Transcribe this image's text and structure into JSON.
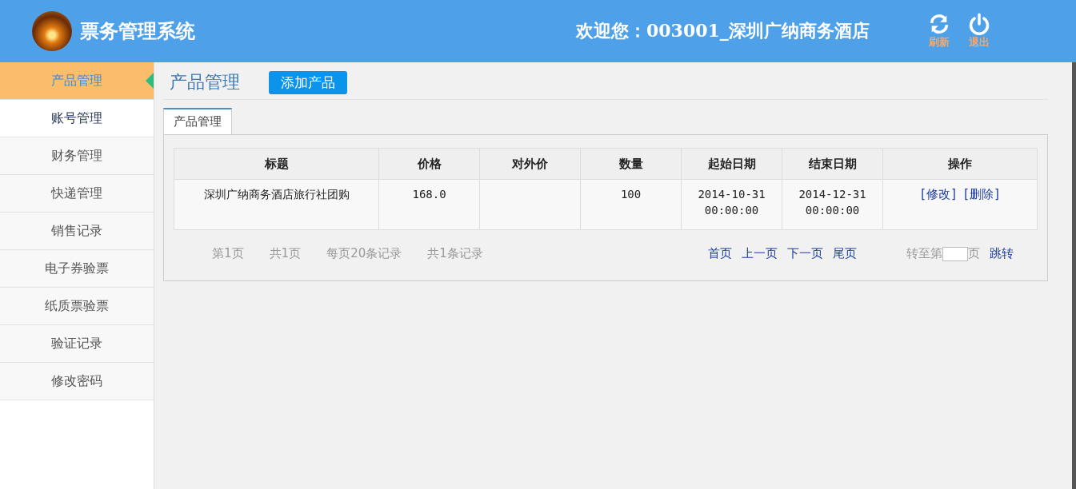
{
  "header": {
    "title": "票务管理系统",
    "welcome": "欢迎您：003001_深圳广纳商务酒店",
    "actions": [
      {
        "kind": "refresh",
        "label": "刷新"
      },
      {
        "kind": "logout",
        "label": "退出"
      }
    ]
  },
  "sidebar": {
    "items": [
      {
        "label": "产品管理",
        "selected": true
      },
      {
        "label": "账号管理",
        "selected": false
      },
      {
        "label": "财务管理",
        "selected": false
      },
      {
        "label": "快递管理",
        "selected": false
      },
      {
        "label": "销售记录",
        "selected": false
      },
      {
        "label": "电子券验票",
        "selected": false
      },
      {
        "label": "纸质票验票",
        "selected": false
      },
      {
        "label": "验证记录",
        "selected": false
      },
      {
        "label": "修改密码",
        "selected": false
      }
    ]
  },
  "page": {
    "title": "产品管理",
    "add_button": "添加产品"
  },
  "tabs": [
    {
      "label": "产品管理",
      "selected": true
    }
  ],
  "table": {
    "columns": [
      "标题",
      "价格",
      "对外价",
      "数量",
      "起始日期",
      "结束日期",
      "操作"
    ],
    "rows": [
      {
        "title": "深圳广纳商务酒店旅行社团购",
        "price": "168.0",
        "quantity": "100",
        "start_date": "2014-10-31 00:00:00",
        "end_date": "2014-12-31 00:00:00",
        "actions": [
          "[修改]",
          "[删除]"
        ]
      }
    ]
  },
  "pagination": {
    "info": [
      "第1页",
      "共1页",
      "每页20条记录",
      "共1条记录"
    ],
    "links": [
      "首页",
      "上一页",
      "下一页",
      "尾页"
    ],
    "goto_prefix": "转至第",
    "goto_suffix": "页",
    "goto_button": "跳转"
  }
}
